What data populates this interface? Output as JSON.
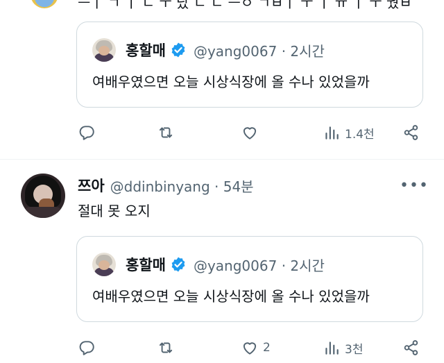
{
  "top_partial": {
    "text": "ㅡㅣ ㄱ ㅣ ㄴ  ㅜ 났 ㄴ ㄴ ㅡㅇ ㄱㅂㅣ ㅜ ㅣ ㅠ ㅣ ㅜ 궜ㅂ"
  },
  "tweets": [
    {
      "quote": {
        "name": "홍할매",
        "handle_time": "@yang0067 · 2시간",
        "body": "여배우였으면 오늘 시상식장에 올 수나 있었을까"
      },
      "actions": {
        "reply_count": "",
        "retweet_count": "",
        "like_count": "",
        "view_count": "1.4천"
      }
    },
    {
      "author": {
        "name": "쯔아",
        "handle_time": "@ddinbinyang · 54분"
      },
      "more": "•••",
      "body": "절대 못 오지",
      "quote": {
        "name": "홍할매",
        "handle_time": "@yang0067 · 2시간",
        "body": "여배우였으면 오늘 시상식장에 올 수나 있었을까"
      },
      "actions": {
        "reply_count": "",
        "retweet_count": "",
        "like_count": "2",
        "view_count": "3천"
      }
    }
  ],
  "colors": {
    "text": "#0f1419",
    "secondary": "#536471",
    "verified": "#1d9bf0",
    "border": "#cfd9de"
  },
  "icons": [
    "reply-icon",
    "retweet-icon",
    "like-icon",
    "views-icon",
    "share-icon",
    "verified-icon",
    "more-icon"
  ]
}
